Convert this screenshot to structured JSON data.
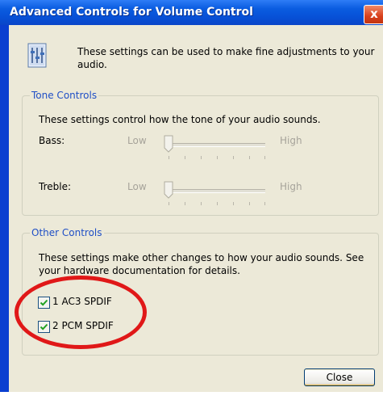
{
  "window": {
    "title": "Advanced Controls for Volume Control",
    "close_glyph": "x"
  },
  "intro": {
    "icon": "advanced-settings-icon",
    "text": "These settings can be used to make fine adjustments to your audio."
  },
  "tone_controls": {
    "legend": "Tone Controls",
    "description": "These settings control how the tone of your audio sounds.",
    "bass": {
      "label": "Bass:",
      "low": "Low",
      "high": "High",
      "value": 0
    },
    "treble": {
      "label": "Treble:",
      "low": "Low",
      "high": "High",
      "value": 0
    }
  },
  "other_controls": {
    "legend": "Other Controls",
    "description": "These settings make other changes to how your audio sounds.  See your hardware documentation for details.",
    "options": [
      {
        "label": "1  AC3 SPDIF",
        "checked": true
      },
      {
        "label": "2  PCM SPDIF",
        "checked": true
      }
    ]
  },
  "buttons": {
    "close": "Close"
  },
  "colors": {
    "title_bar": "#0a5ce0",
    "dialog_bg": "#ece9d8",
    "group_label": "#1f4fc6",
    "annotation_circle": "#e01818"
  }
}
